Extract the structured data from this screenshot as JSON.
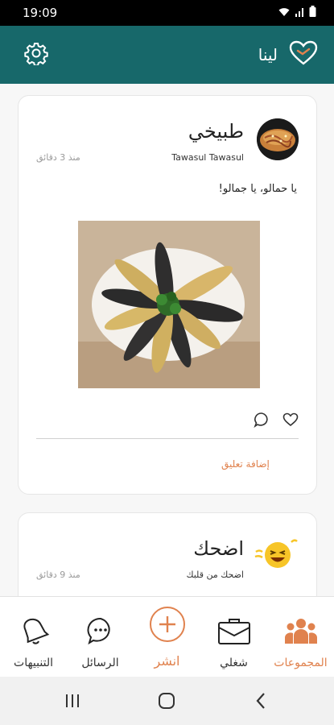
{
  "status_bar": {
    "time": "19:09",
    "icons": [
      "wifi-icon",
      "signal-icon",
      "battery-icon"
    ]
  },
  "app_bar": {
    "username": "لينا",
    "icons": [
      "heart-logo-icon",
      "settings-gear-icon"
    ],
    "background_color": "#17686a"
  },
  "posts": [
    {
      "group_name": "طبيخي",
      "author": "Tawasul Tawasul",
      "time_ago": "منذ 3 دقائق",
      "text": "يا حمالو، يا جمالو!",
      "add_comment_label": "إضافة تعليق",
      "icons": [
        "heart-outline-icon",
        "comment-bubble-icon"
      ]
    },
    {
      "group_name": "اضحك",
      "author": "اضحك من قلبك",
      "time_ago": "منذ 9 دقائق",
      "icons": [
        "laughing-emoji-icon"
      ]
    }
  ],
  "bottom_nav": {
    "groups": "المجموعات",
    "my_work": "شغلي",
    "publish": "انشر",
    "messages": "الرسائل",
    "notifications": "التنبيهات",
    "active_item": "groups",
    "accent_color": "#e0824e"
  },
  "system_nav": {
    "icons": [
      "recent-apps-icon",
      "home-icon",
      "back-icon"
    ]
  }
}
